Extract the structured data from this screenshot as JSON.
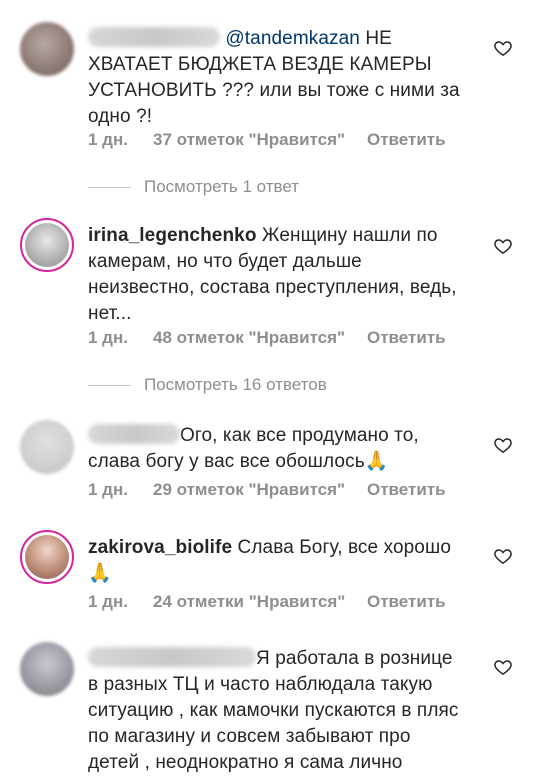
{
  "comments": [
    {
      "mention": "@tandemkazan",
      "text": " НЕ ХВАТАЕТ БЮДЖЕТА ВЕЗДЕ КАМЕРЫ УСТАНОВИТЬ ??? или вы тоже с ними за одно ?!",
      "time": "1 дн.",
      "likes": "37 отметок \"Нравится\"",
      "reply": "Ответить",
      "view_replies": "Посмотреть 1 ответ"
    },
    {
      "username": "irina_legenchenko",
      "text": " Женщину нашли по камерам, но что будет дальше неизвестно,  состава преступления, ведь, нет...",
      "time": "1 дн.",
      "likes": "48 отметок \"Нравится\"",
      "reply": "Ответить",
      "view_replies": "Посмотреть 16 ответов"
    },
    {
      "text": "Ого, как все продумано то, слава богу у вас все обошлось🙏",
      "time": "1 дн.",
      "likes": "29 отметок \"Нравится\"",
      "reply": "Ответить"
    },
    {
      "username": "zakirova_biolife",
      "text": " Слава Богу, все хорошо 🙏",
      "time": "1 дн.",
      "likes": "24 отметки \"Нравится\"",
      "reply": "Ответить"
    },
    {
      "text": "Я работала  в рознице в разных ТЦ  и часто наблюдала такую ситуацию , как мамочки  пускаются в пляс по магазину и совсем забывают про детей , неоднократно я сама лично"
    }
  ],
  "icons": {
    "like": "heart-outline-icon"
  },
  "colors": {
    "meta": "#8e8e8e",
    "mention": "#00376b",
    "story_ring": "#d6249f"
  }
}
